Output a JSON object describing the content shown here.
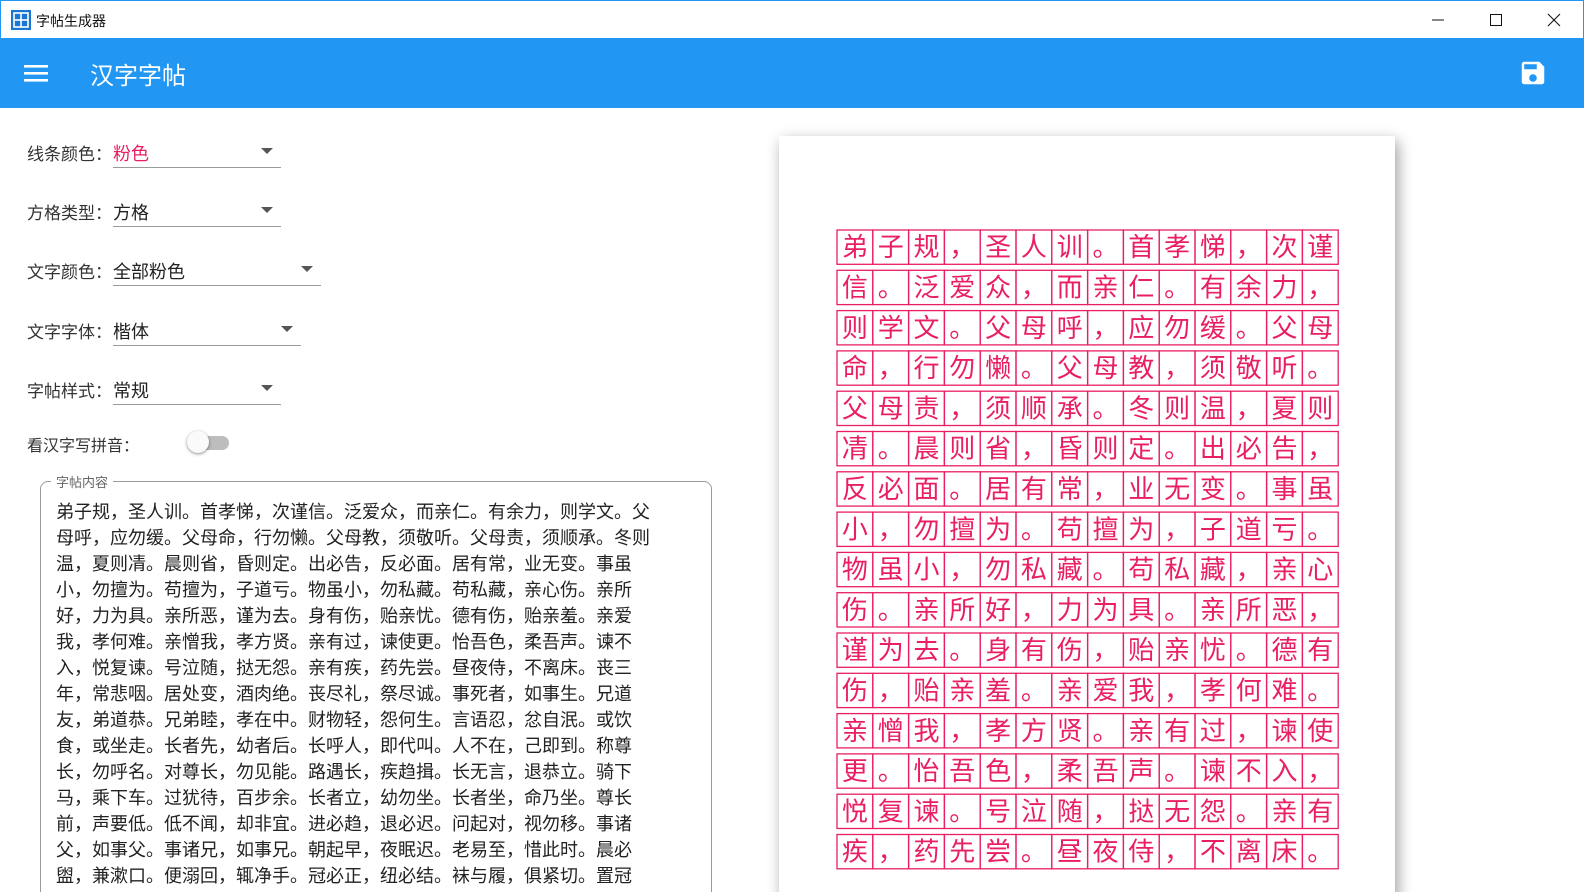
{
  "window": {
    "title": "字帖生成器"
  },
  "appbar": {
    "title": "汉字字帖"
  },
  "colors": {
    "accent": "#2196f3",
    "pink": "#e91e63"
  },
  "settings": {
    "line_color": {
      "label": "线条颜色：",
      "value": "粉色"
    },
    "grid_type": {
      "label": "方格类型：",
      "value": "方格"
    },
    "text_color": {
      "label": "文字颜色：",
      "value": "全部粉色"
    },
    "text_font": {
      "label": "文字字体：",
      "value": "楷体"
    },
    "copybook_style": {
      "label": "字帖样式：",
      "value": "常规"
    },
    "pinyin_toggle": {
      "label": "看汉字写拼音：",
      "checked": false
    }
  },
  "content": {
    "legend": "字帖内容",
    "lines": [
      "弟子规，圣人训。首孝悌，次谨信。泛爱众，而亲仁。有余力，则学文。父",
      "母呼，应勿缓。父母命，行勿懒。父母教，须敬听。父母责，须顺承。冬则",
      "温，夏则凊。晨则省，昏则定。出必告，反必面。居有常，业无变。事虽",
      "小，勿擅为。苟擅为，子道亏。物虽小，勿私藏。苟私藏，亲心伤。亲所",
      "好，力为具。亲所恶，谨为去。身有伤，贻亲忧。德有伤，贻亲羞。亲爱",
      "我，孝何难。亲憎我，孝方贤。亲有过，谏使更。怡吾色，柔吾声。谏不",
      "入，悦复谏。号泣随，挞无怨。亲有疾，药先尝。昼夜侍，不离床。丧三",
      "年，常悲咽。居处变，酒肉绝。丧尽礼，祭尽诚。事死者，如事生。兄道",
      "友，弟道恭。兄弟睦，孝在中。财物轻，怨何生。言语忍，忿自泯。或饮",
      "食，或坐走。长者先，幼者后。长呼人，即代叫。人不在，己即到。称尊",
      "长，勿呼名。对尊长，勿见能。路遇长，疾趋揖。长无言，退恭立。骑下",
      "马，乘下车。过犹待，百步余。长者立，幼勿坐。长者坐，命乃坐。尊长",
      "前，声要低。低不闻，却非宜。进必趋，退必迟。问起对，视勿移。事诸",
      "父，如事父。事诸兄，如事兄。朝起早，夜眠迟。老易至，惜此时。晨必",
      "盥，兼漱口。便溺回，辄净手。冠必正，纽必结。袜与履，俱紧切。置冠"
    ]
  },
  "preview": {
    "rows": [
      "弟子规，圣人训。首孝悌，次谨",
      "信。泛爱众，而亲仁。有余力，",
      "则学文。父母呼，应勿缓。父母",
      "命，行勿懒。父母教，须敬听。",
      "父母责，须顺承。冬则温，夏则",
      "凊。晨则省，昏则定。出必告，",
      "反必面。居有常，业无变。事虽",
      "小，勿擅为。苟擅为，子道亏。",
      "物虽小，勿私藏。苟私藏，亲心",
      "伤。亲所好，力为具。亲所恶，",
      "谨为去。身有伤，贻亲忧。德有",
      "伤，贻亲羞。亲爱我，孝何难。",
      "亲憎我，孝方贤。亲有过，谏使",
      "更。怡吾色，柔吾声。谏不入，",
      "悦复谏。号泣随，挞无怨。亲有",
      "疾，药先尝。昼夜侍，不离床。"
    ]
  }
}
